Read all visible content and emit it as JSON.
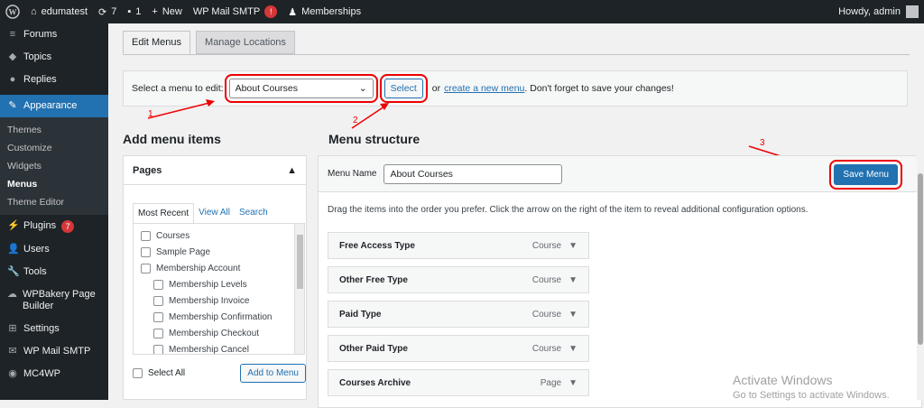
{
  "adminbar": {
    "wp_icon": "wordpress-logo-icon",
    "site": "edumatest",
    "updates": "7",
    "comments": "1",
    "new": "New",
    "wpmail": "WP Mail SMTP",
    "wpmail_badge": "!",
    "memberships": "Memberships",
    "howdy": "Howdy, admin"
  },
  "sidebar": {
    "items": [
      {
        "label": "Forums",
        "icon": "forums-icon"
      },
      {
        "label": "Topics",
        "icon": "topics-icon"
      },
      {
        "label": "Replies",
        "icon": "replies-icon"
      },
      {
        "label": "Appearance",
        "icon": "appearance-icon"
      },
      {
        "label": "Plugins",
        "icon": "plugins-icon",
        "badge": "7"
      },
      {
        "label": "Users",
        "icon": "users-icon"
      },
      {
        "label": "Tools",
        "icon": "tools-icon"
      },
      {
        "label": "WPBakery Page Builder",
        "icon": "wpbakery-icon"
      },
      {
        "label": "Settings",
        "icon": "settings-icon"
      },
      {
        "label": "WP Mail SMTP",
        "icon": "mail-icon"
      },
      {
        "label": "MC4WP",
        "icon": "mc4wp-icon"
      }
    ],
    "submenu": [
      "Themes",
      "Customize",
      "Widgets",
      "Menus",
      "Theme Editor"
    ]
  },
  "tabs": {
    "edit": "Edit Menus",
    "manage": "Manage Locations"
  },
  "select_menu": {
    "label": "Select a menu to edit:",
    "value": "About Courses",
    "button": "Select",
    "or": "or",
    "create_link": "create a new menu",
    "tail": ". Don't forget to save your changes!"
  },
  "add_items": {
    "title": "Add menu items",
    "pages_title": "Pages",
    "tabs": [
      "Most Recent",
      "View All",
      "Search"
    ],
    "pages": [
      {
        "label": "Courses",
        "indent": 0
      },
      {
        "label": "Sample Page",
        "indent": 0
      },
      {
        "label": "Membership Account",
        "indent": 0
      },
      {
        "label": "Membership Levels",
        "indent": 1
      },
      {
        "label": "Membership Invoice",
        "indent": 1
      },
      {
        "label": "Membership Confirmation",
        "indent": 1
      },
      {
        "label": "Membership Checkout",
        "indent": 1
      },
      {
        "label": "Membership Cancel",
        "indent": 1
      }
    ],
    "select_all": "Select All",
    "add_button": "Add to Menu"
  },
  "structure": {
    "title": "Menu structure",
    "name_label": "Menu Name",
    "name_value": "About Courses",
    "save": "Save Menu",
    "instructions": "Drag the items into the order you prefer. Click the arrow on the right of the item to reveal additional configuration options.",
    "items": [
      {
        "label": "Free Access Type",
        "type": "Course"
      },
      {
        "label": "Other Free Type",
        "type": "Course"
      },
      {
        "label": "Paid Type",
        "type": "Course"
      },
      {
        "label": "Other Paid Type",
        "type": "Course"
      },
      {
        "label": "Courses Archive",
        "type": "Page"
      }
    ]
  },
  "annotations": [
    "1",
    "2",
    "3"
  ],
  "watermark": {
    "line1": "Activate Windows",
    "line2": "Go to Settings to activate Windows."
  },
  "colors": {
    "annotation": "#ee0000",
    "primary": "#2271b1",
    "sidebar": "#1d2327"
  }
}
